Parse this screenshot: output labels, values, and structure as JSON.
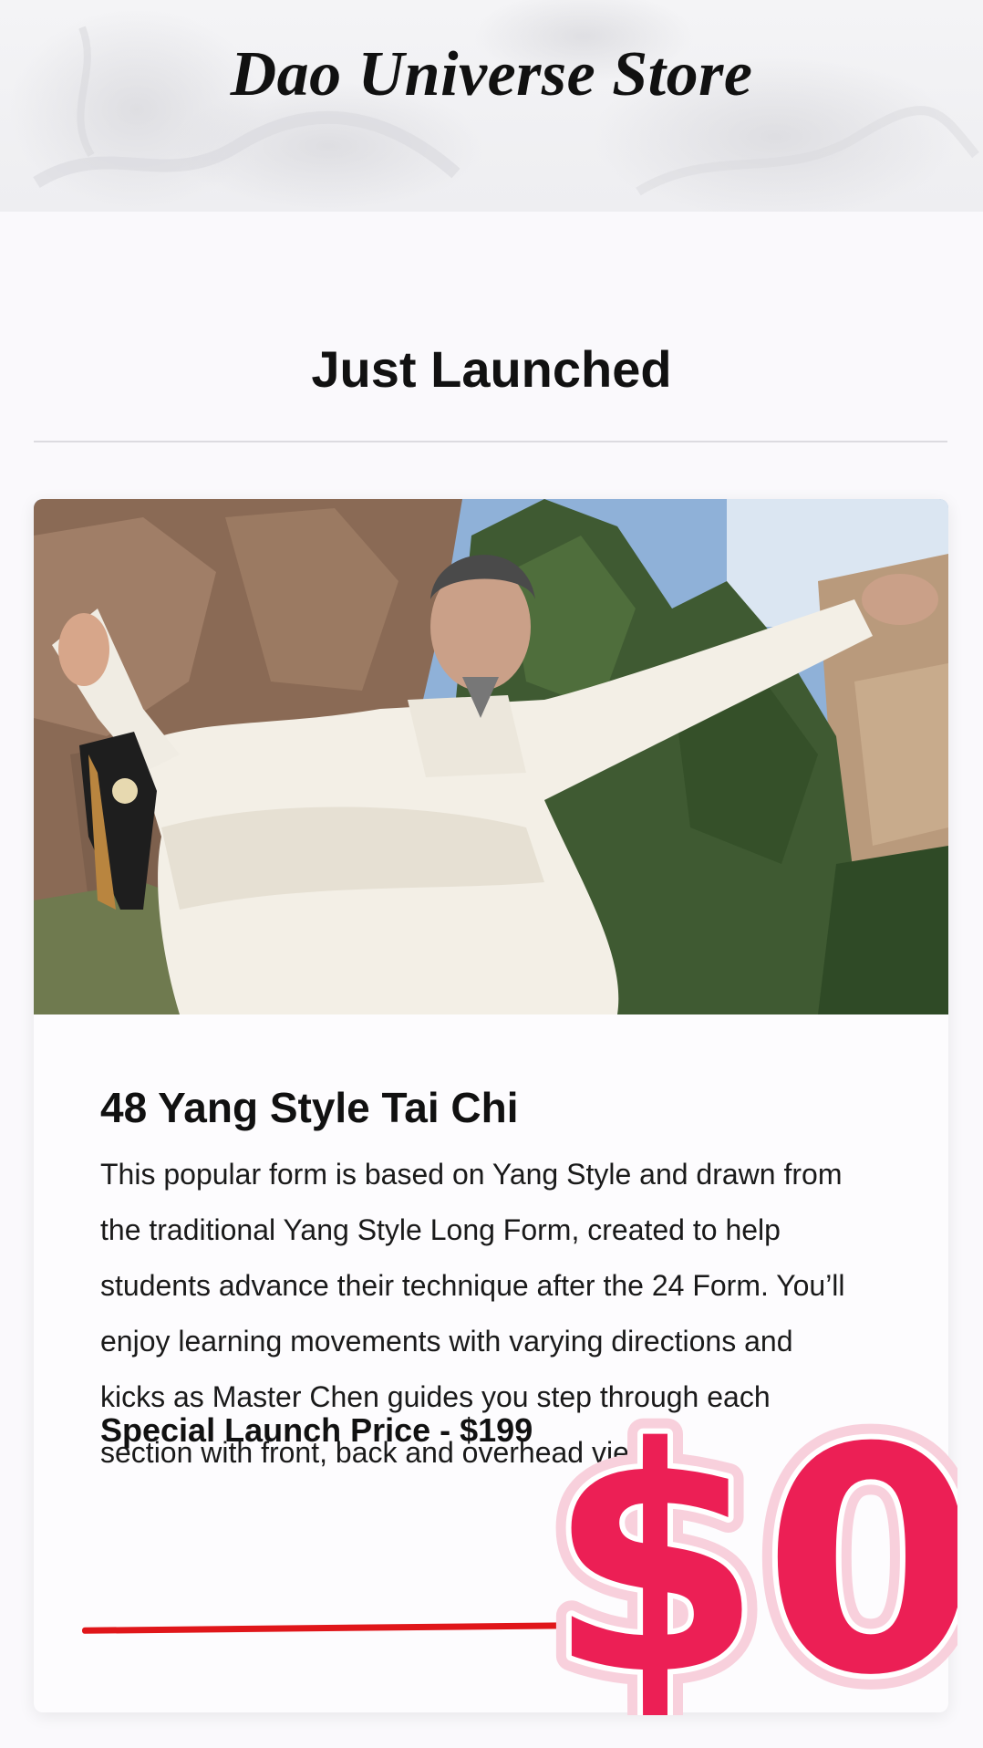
{
  "header": {
    "store_title": "Dao Universe Store"
  },
  "section": {
    "title": "Just Launched"
  },
  "product": {
    "name": "48 Yang Style Tai Chi",
    "description": "This popular form is based on Yang Style and drawn from the traditional Yang Style Long Form, created to help students advance their technique after the 24 Form. You’ll enjoy learning movements with varying directions and kicks as Master Chen guides you step through each section with front, back and overhead views.",
    "old_price_label": "Special Launch Price - $199",
    "new_price": "$0",
    "image_icon": "tai-chi-master-photo"
  },
  "colors": {
    "price_pink": "#ec1f55",
    "strike_red": "#e0161a",
    "text": "#111111"
  }
}
